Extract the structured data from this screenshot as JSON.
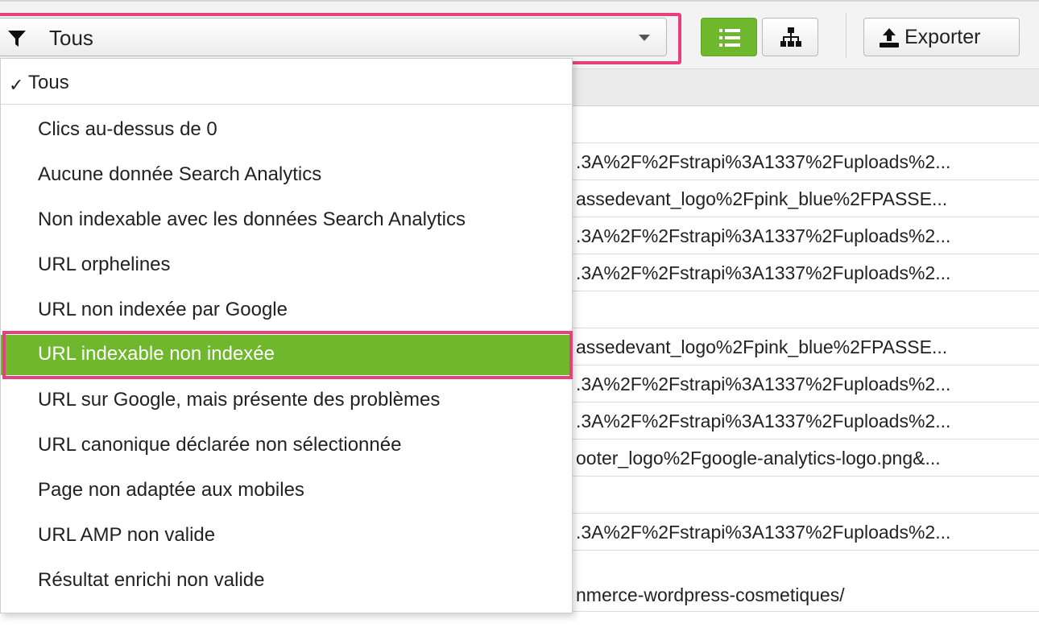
{
  "toolbar": {
    "filter": {
      "label": "Tous",
      "icon": "filter-icon"
    },
    "view_list_icon": "list-icon",
    "view_tree_icon": "sitemap-icon",
    "export": {
      "label": "Exporter",
      "icon": "upload-icon"
    }
  },
  "dropdown": {
    "selected": "Tous",
    "items": [
      "Clics au-dessus de 0",
      "Aucune donnée Search Analytics",
      "Non indexable avec les données Search Analytics",
      "URL orphelines",
      "URL non indexée par Google",
      "URL indexable non indexée",
      "URL sur Google, mais présente des problèmes",
      "URL canonique déclarée non sélectionnée",
      "Page non adaptée aux mobiles",
      "URL AMP non valide",
      "Résultat enrichi non valide"
    ],
    "active_index": 5
  },
  "table": {
    "rows": [
      "",
      ".3A%2F%2Fstrapi%3A1337%2Fuploads%2...",
      "assedevant_logo%2Fpink_blue%2FPASSE...",
      ".3A%2F%2Fstrapi%3A1337%2Fuploads%2...",
      ".3A%2F%2Fstrapi%3A1337%2Fuploads%2...",
      "",
      "assedevant_logo%2Fpink_blue%2FPASSE...",
      ".3A%2F%2Fstrapi%3A1337%2Fuploads%2...",
      ".3A%2F%2Fstrapi%3A1337%2Fuploads%2...",
      "ooter_logo%2Fgoogle-analytics-logo.png&...",
      "",
      ".3A%2F%2Fstrapi%3A1337%2Fuploads%2..."
    ],
    "last_row": "nmerce-wordpress-cosmetiques/"
  },
  "colors": {
    "accent_green": "#6fb72d",
    "highlight_pink": "#e8407e"
  }
}
